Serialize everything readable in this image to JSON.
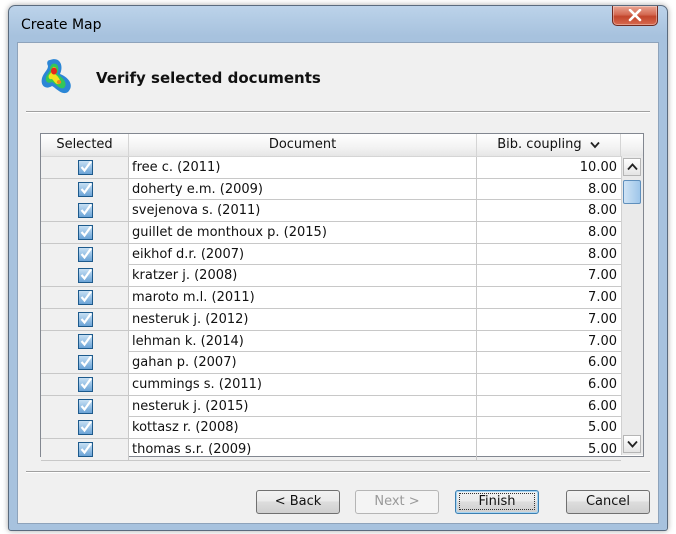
{
  "window": {
    "title": "Create Map"
  },
  "header": {
    "title": "Verify selected documents",
    "icon": "map-cluster-icon"
  },
  "table": {
    "columns": {
      "selected": "Selected",
      "document": "Document",
      "bib": "Bib. coupling",
      "sort_icon": "chevron-down-icon"
    },
    "rows": [
      {
        "document": "free c. (2011)",
        "bib": "10.00",
        "selected": true
      },
      {
        "document": "doherty e.m. (2009)",
        "bib": "8.00",
        "selected": true
      },
      {
        "document": "svejenova s. (2011)",
        "bib": "8.00",
        "selected": true
      },
      {
        "document": "guillet de monthoux p. (2015)",
        "bib": "8.00",
        "selected": true
      },
      {
        "document": "eikhof d.r. (2007)",
        "bib": "8.00",
        "selected": true
      },
      {
        "document": "kratzer j. (2008)",
        "bib": "7.00",
        "selected": true
      },
      {
        "document": "maroto m.l. (2011)",
        "bib": "7.00",
        "selected": true
      },
      {
        "document": "nesteruk j. (2012)",
        "bib": "7.00",
        "selected": true
      },
      {
        "document": "lehman k. (2014)",
        "bib": "7.00",
        "selected": true
      },
      {
        "document": "gahan p. (2007)",
        "bib": "6.00",
        "selected": true
      },
      {
        "document": "cummings s. (2011)",
        "bib": "6.00",
        "selected": true
      },
      {
        "document": "nesteruk j. (2015)",
        "bib": "6.00",
        "selected": true
      },
      {
        "document": "kottasz r. (2008)",
        "bib": "5.00",
        "selected": true
      },
      {
        "document": "thomas s.r. (2009)",
        "bib": "5.00",
        "selected": true
      }
    ]
  },
  "buttons": {
    "back": "< Back",
    "next": "Next >",
    "finish": "Finish",
    "cancel": "Cancel"
  },
  "colors": {
    "accent": "#3c7fb1",
    "close": "#c2452c",
    "checkbox": "#6aa3d6"
  }
}
